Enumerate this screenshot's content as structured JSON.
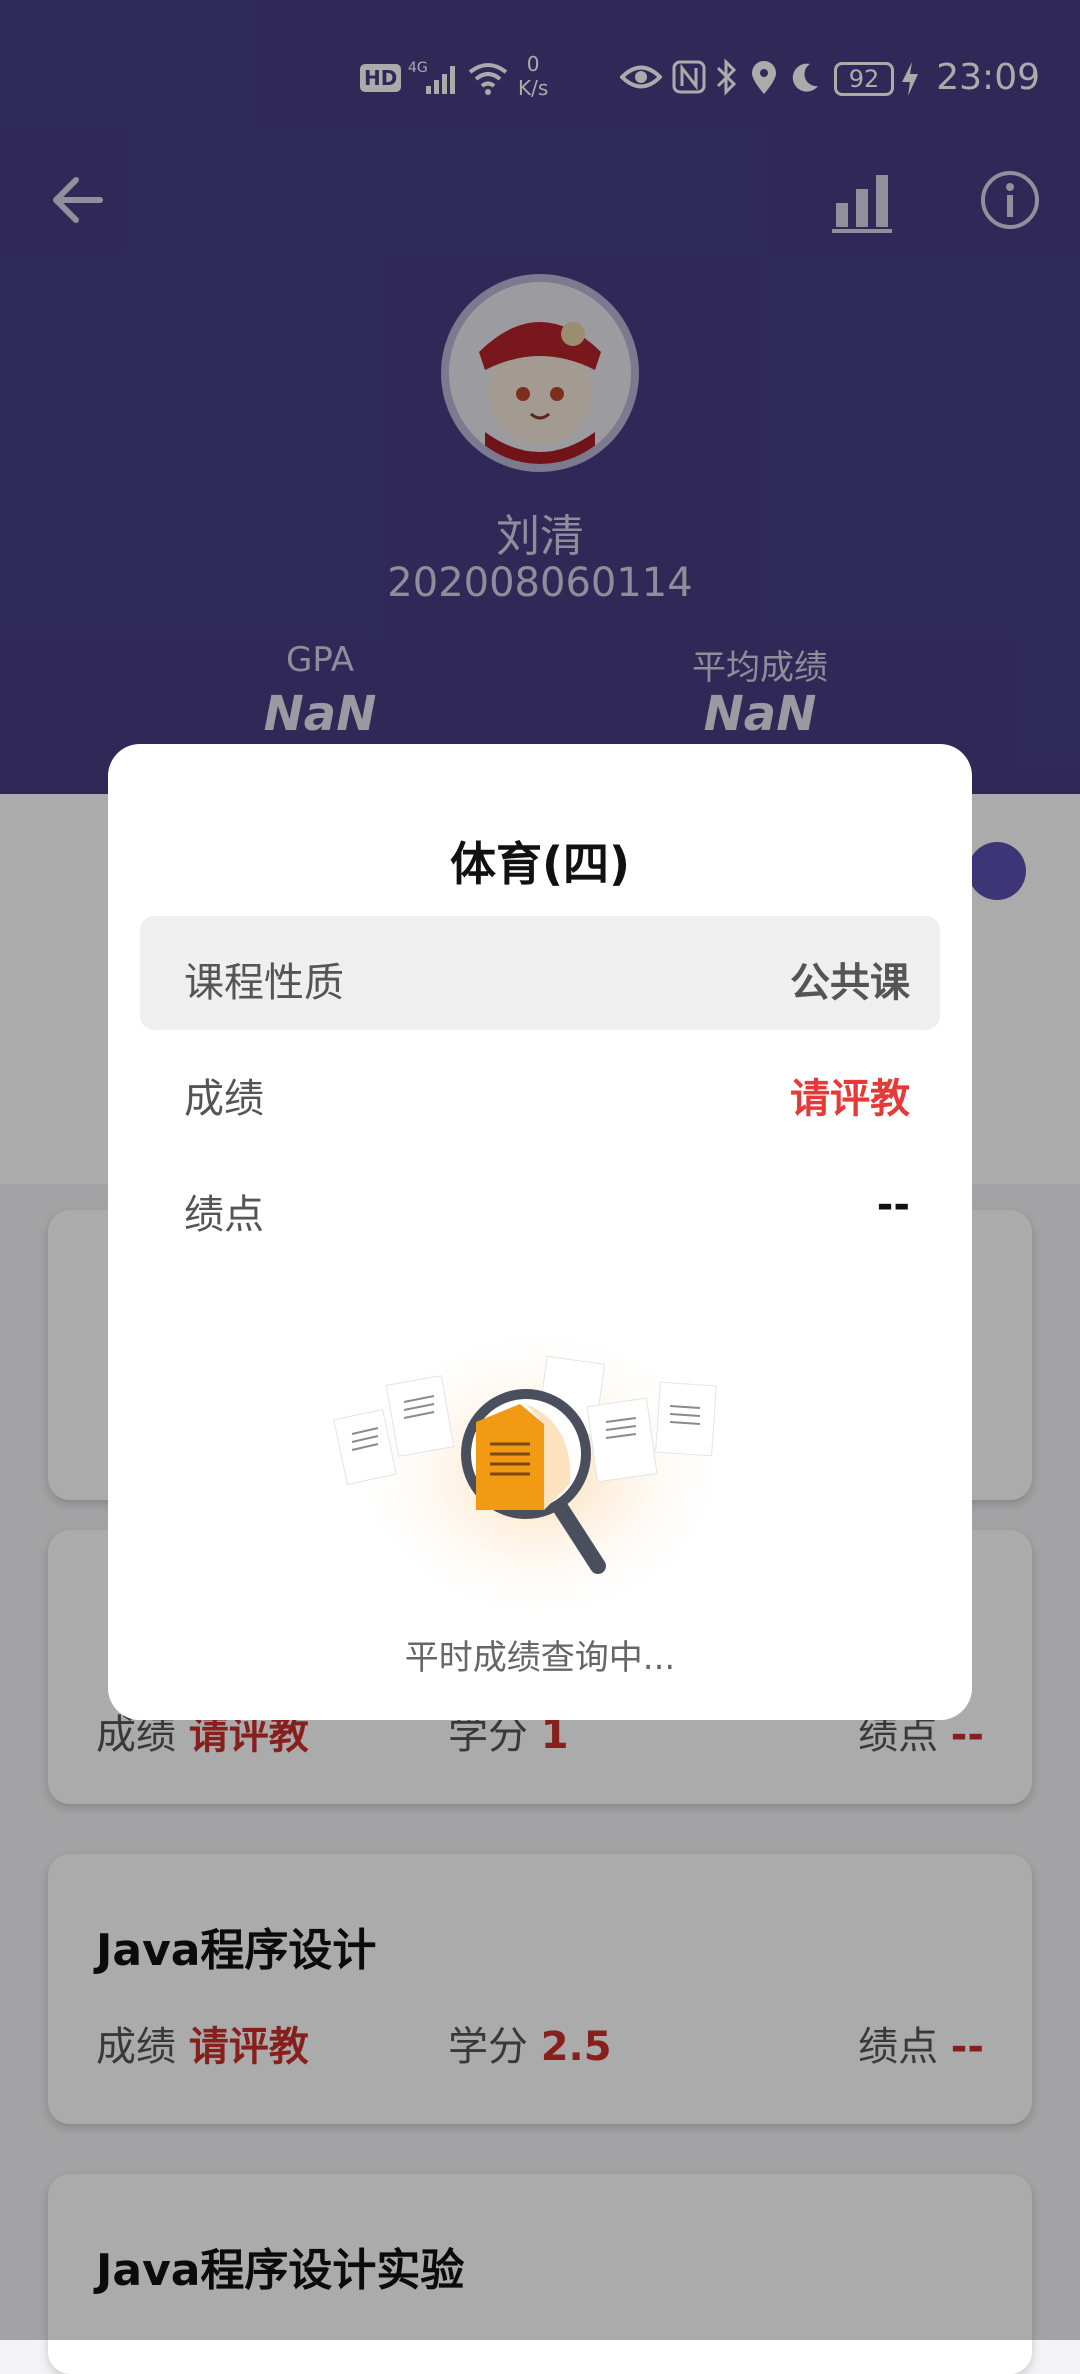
{
  "status_bar": {
    "hd": "HD",
    "net_speed_value": "0",
    "net_speed_unit": "K/s",
    "battery": "92",
    "time": "23:09"
  },
  "header": {
    "student_name": "刘清",
    "student_id": "202008060114",
    "gpa_label": "GPA",
    "gpa_value": "NaN",
    "avg_label": "平均成绩",
    "avg_value": "NaN"
  },
  "courses": [
    {
      "title": "Java程序设计",
      "score_label": "成绩",
      "score_value": "请评教",
      "credit_label": "学分",
      "credit_value": "2.5",
      "gp_label": "绩点",
      "gp_value": "--"
    },
    {
      "title": "Java程序设计实验"
    }
  ],
  "partial_card": {
    "score_label": "成绩",
    "score_value": "请评教",
    "credit_label": "学分",
    "credit_value": "1",
    "gp_label": "绩点",
    "gp_value": "--"
  },
  "dialog": {
    "title": "体育(四)",
    "rows": [
      {
        "label": "课程性质",
        "value": "公共课"
      },
      {
        "label": "成绩",
        "value": "请评教"
      },
      {
        "label": "绩点",
        "value": "--"
      }
    ],
    "loading_text": "平时成绩查询中..."
  },
  "icons": [
    "back-arrow-icon",
    "bar-chart-icon",
    "info-icon",
    "magnifier-icon",
    "document-icon"
  ],
  "colors": {
    "header": "#483e84",
    "accent_red": "#e5393a",
    "toggle": "#5b4fb0"
  }
}
